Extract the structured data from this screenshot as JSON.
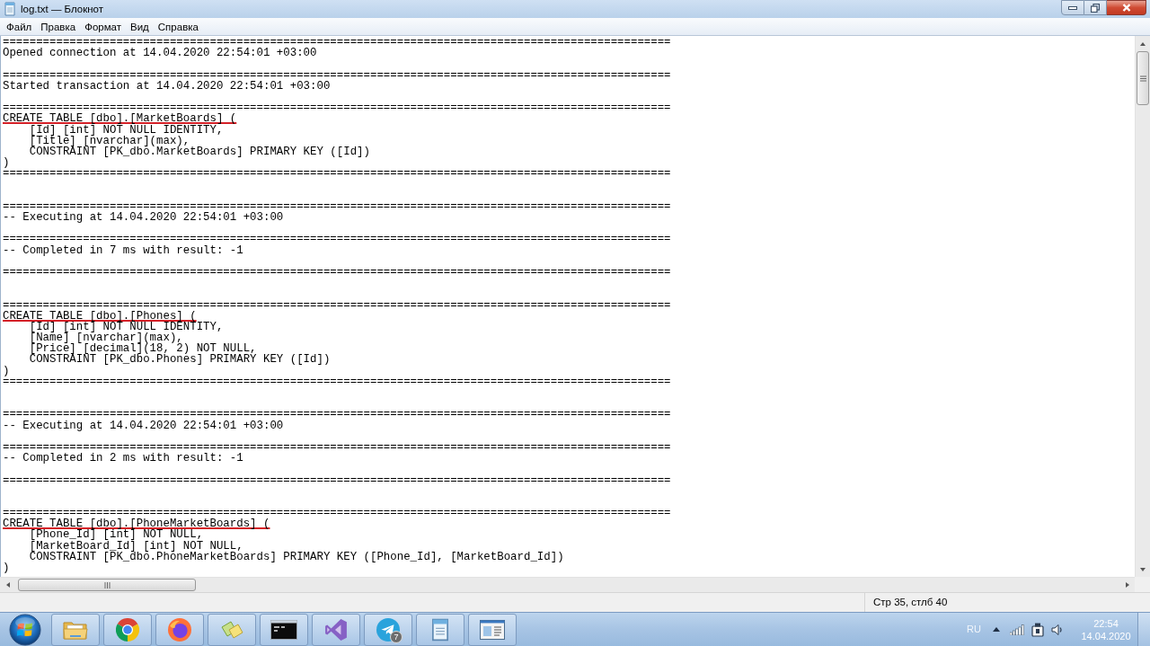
{
  "window": {
    "title": "log.txt — Блокнот"
  },
  "menu": [
    "Файл",
    "Правка",
    "Формат",
    "Вид",
    "Справка"
  ],
  "document": {
    "lines": [
      {
        "kind": "text",
        "text": "====================================================================================================",
        "underlined": false
      },
      {
        "kind": "text",
        "text": "Opened connection at 14.04.2020 22:54:01 +03:00",
        "underlined": false
      },
      {
        "kind": "blank"
      },
      {
        "kind": "text",
        "text": "====================================================================================================",
        "underlined": false
      },
      {
        "kind": "text",
        "text": "Started transaction at 14.04.2020 22:54:01 +03:00",
        "underlined": false
      },
      {
        "kind": "blank"
      },
      {
        "kind": "text",
        "text": "====================================================================================================",
        "underlined": false
      },
      {
        "kind": "text",
        "text": "CREATE TABLE [dbo].[MarketBoards] (",
        "underlined": true
      },
      {
        "kind": "text",
        "text": "    [Id] [int] NOT NULL IDENTITY,",
        "underlined": false
      },
      {
        "kind": "text",
        "text": "    [Title] [nvarchar](max),",
        "underlined": false
      },
      {
        "kind": "text",
        "text": "    CONSTRAINT [PK_dbo.MarketBoards] PRIMARY KEY ([Id])",
        "underlined": false
      },
      {
        "kind": "text",
        "text": ")",
        "underlined": false
      },
      {
        "kind": "text",
        "text": "====================================================================================================",
        "underlined": false
      },
      {
        "kind": "blank"
      },
      {
        "kind": "blank"
      },
      {
        "kind": "text",
        "text": "====================================================================================================",
        "underlined": false
      },
      {
        "kind": "text",
        "text": "-- Executing at 14.04.2020 22:54:01 +03:00",
        "underlined": false
      },
      {
        "kind": "blank"
      },
      {
        "kind": "text",
        "text": "====================================================================================================",
        "underlined": false
      },
      {
        "kind": "text",
        "text": "-- Completed in 7 ms with result: -1",
        "underlined": false
      },
      {
        "kind": "blank"
      },
      {
        "kind": "text",
        "text": "====================================================================================================",
        "underlined": false
      },
      {
        "kind": "blank"
      },
      {
        "kind": "blank"
      },
      {
        "kind": "text",
        "text": "====================================================================================================",
        "underlined": false
      },
      {
        "kind": "text",
        "text": "CREATE TABLE [dbo].[Phones] (",
        "underlined": true
      },
      {
        "kind": "text",
        "text": "    [Id] [int] NOT NULL IDENTITY,",
        "underlined": false
      },
      {
        "kind": "text",
        "text": "    [Name] [nvarchar](max),",
        "underlined": false
      },
      {
        "kind": "text",
        "text": "    [Price] [decimal](18, 2) NOT NULL,",
        "underlined": false
      },
      {
        "kind": "text",
        "text": "    CONSTRAINT [PK_dbo.Phones] PRIMARY KEY ([Id])",
        "underlined": false
      },
      {
        "kind": "text",
        "text": ")",
        "underlined": false
      },
      {
        "kind": "text",
        "text": "====================================================================================================",
        "underlined": false
      },
      {
        "kind": "blank"
      },
      {
        "kind": "blank"
      },
      {
        "kind": "text",
        "text": "====================================================================================================",
        "underlined": false
      },
      {
        "kind": "text",
        "text": "-- Executing at 14.04.2020 22:54:01 +03:00",
        "underlined": false
      },
      {
        "kind": "blank"
      },
      {
        "kind": "text",
        "text": "====================================================================================================",
        "underlined": false
      },
      {
        "kind": "text",
        "text": "-- Completed in 2 ms with result: -1",
        "underlined": false
      },
      {
        "kind": "blank"
      },
      {
        "kind": "text",
        "text": "====================================================================================================",
        "underlined": false
      },
      {
        "kind": "blank"
      },
      {
        "kind": "blank"
      },
      {
        "kind": "text",
        "text": "====================================================================================================",
        "underlined": false
      },
      {
        "kind": "text",
        "text": "CREATE TABLE [dbo].[PhoneMarketBoards] (",
        "underlined": true
      },
      {
        "kind": "text",
        "text": "    [Phone_Id] [int] NOT NULL,",
        "underlined": false
      },
      {
        "kind": "text",
        "text": "    [MarketBoard_Id] [int] NOT NULL,",
        "underlined": false
      },
      {
        "kind": "text",
        "text": "    CONSTRAINT [PK_dbo.PhoneMarketBoards] PRIMARY KEY ([Phone_Id], [MarketBoard_Id])",
        "underlined": false
      },
      {
        "kind": "text",
        "text": ")",
        "underlined": false
      }
    ]
  },
  "status_bar": {
    "position": "Стр 35, стлб 40"
  },
  "taskbar": {
    "badge": "7",
    "language": "RU",
    "time": "22:54",
    "date": "14.04.2020"
  }
}
